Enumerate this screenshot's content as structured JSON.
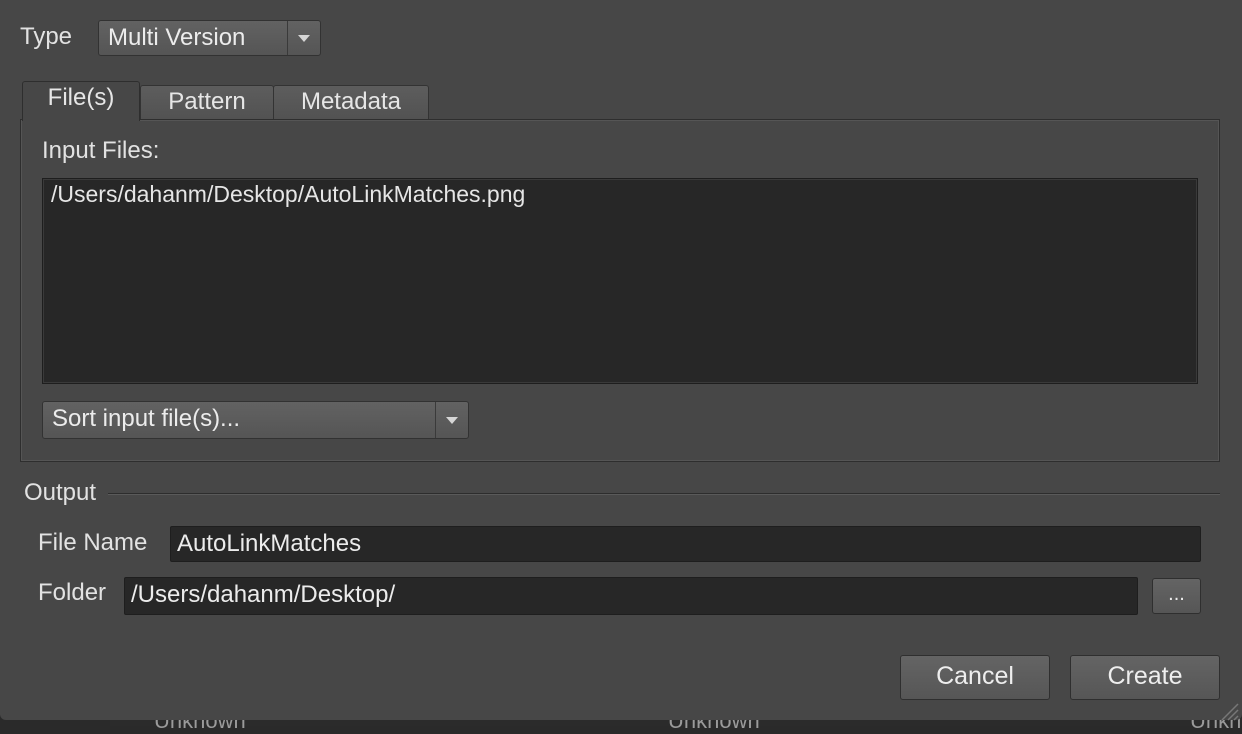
{
  "type_row": {
    "label": "Type",
    "selected": "Multi Version"
  },
  "tabs": [
    {
      "label": "File(s)",
      "active": true
    },
    {
      "label": "Pattern",
      "active": false
    },
    {
      "label": "Metadata",
      "active": false
    }
  ],
  "files_tab": {
    "input_label": "Input Files:",
    "files": [
      "/Users/dahanm/Desktop/AutoLinkMatches.png"
    ],
    "sort_selected": "Sort input file(s)..."
  },
  "output": {
    "section_label": "Output",
    "file_name_label": "File Name",
    "file_name_value": "AutoLinkMatches",
    "folder_label": "Folder",
    "folder_value": "/Users/dahanm/Desktop/",
    "browse_label": "..."
  },
  "actions": {
    "cancel_label": "Cancel",
    "create_label": "Create"
  },
  "background_peek": [
    "Unknown",
    "Unknown",
    "Unkn"
  ],
  "colors": {
    "dialog_bg": "#474747",
    "field_bg": "#272727",
    "text": "#e2e2e2"
  }
}
